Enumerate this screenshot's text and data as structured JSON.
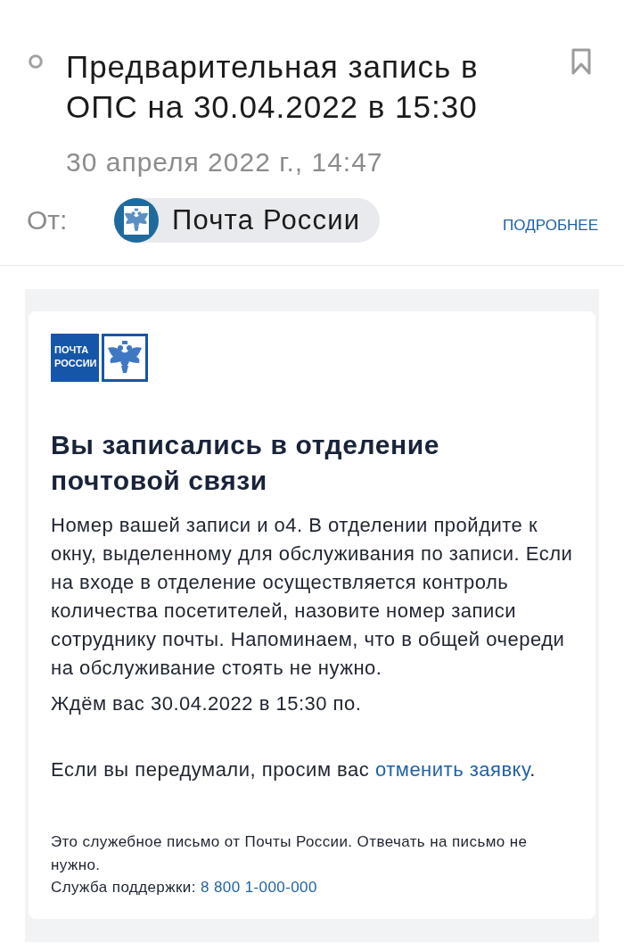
{
  "message": {
    "title": "Предварительная запись в ОПС на 30.04.2022 в 15:30",
    "date": "30 апреля 2022 г., 14:47"
  },
  "sender": {
    "label": "От:",
    "name": "Почта России",
    "details": "ПОДРОБНЕЕ"
  },
  "email": {
    "logo_text": "ПОЧТА РОССИИ",
    "heading": "Вы записались в отделение почтовой связи",
    "paragraphs": [
      "Номер вашей записи и о4. В отделении пройдите к окну, выделенному для обслуживания по записи. Если на входе в отделение осуществляется контроль количества посетителей, назовите номер записи сотруднику почты. Напоминаем, что в общей очереди на обслуживание стоять не нужно.",
      "Ждём вас 30.04.2022 в 15:30 по."
    ],
    "cancel": {
      "text": "Если вы передумали, просим вас",
      "link": "отменить заявку",
      "end": "."
    },
    "footer": {
      "note": "Это служебное письмо от Почты России. Отвечать на письмо не нужно.",
      "support_label": "Служба поддержки:",
      "phone": "8 800 1-000-000"
    }
  }
}
